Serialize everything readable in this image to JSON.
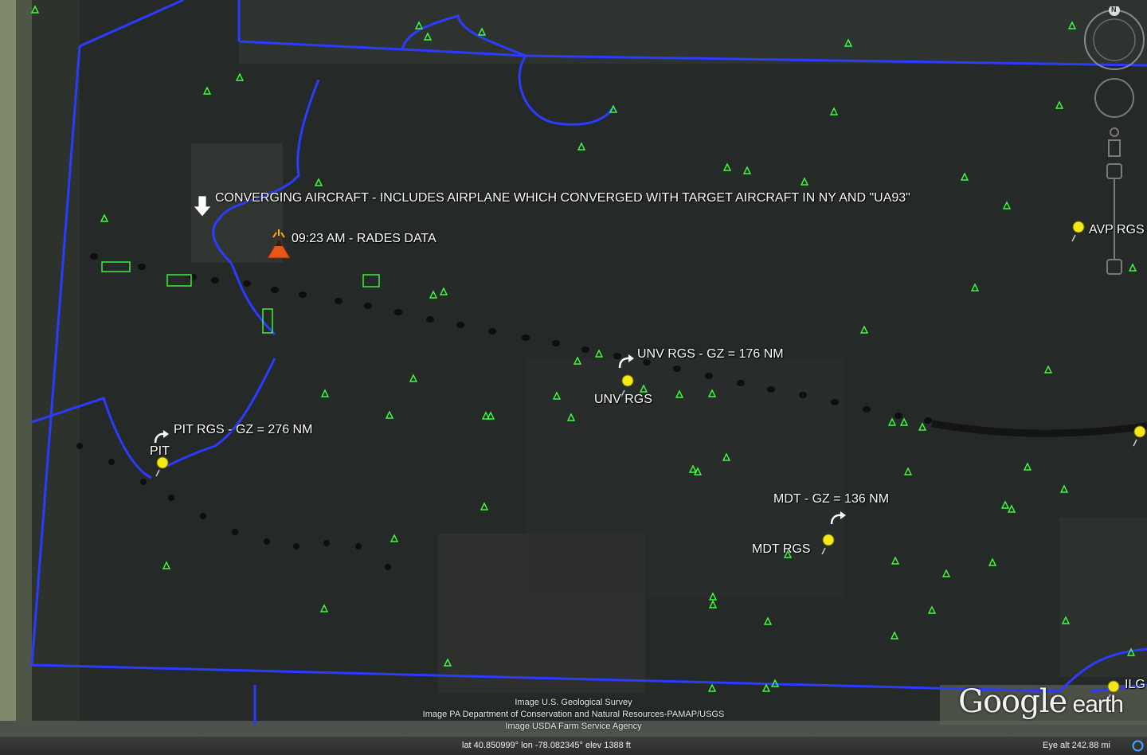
{
  "labels": {
    "converging": "CONVERGING AIRCRAFT - INCLUDES AIRPLANE WHICH CONVERGED WITH TARGET AIRCRAFT IN NY AND \"UA93\"",
    "rades": "09:23 AM - RADES DATA",
    "unv_gz": "UNV RGS - GZ = 176 NM",
    "unv": "UNV RGS",
    "pit_gz": "PIT RGS - GZ = 276 NM",
    "pit": "PIT",
    "mdt_gz": "MDT - GZ = 136 NM",
    "mdt": "MDT RGS",
    "avp": "AVP RGS",
    "ilg": "ILG"
  },
  "credits": {
    "line1": "Image U.S. Geological Survey",
    "line2": "Image PA Department of Conservation and Natural Resources-PAMAP/USGS",
    "line3": "Image USDA Farm Service Agency"
  },
  "status": {
    "lat": "lat   40.850999°  lon  -78.082345°  elev  1388 ft",
    "eye": "Eye alt    242.88 mi"
  },
  "logo": {
    "main": "Google",
    "sub": " earth"
  },
  "compass": {
    "north": "N"
  },
  "colors": {
    "border": "#2b3bff",
    "pin": "#f2e81a",
    "marker": "#3cff3c",
    "track": "#0e0e0e"
  }
}
